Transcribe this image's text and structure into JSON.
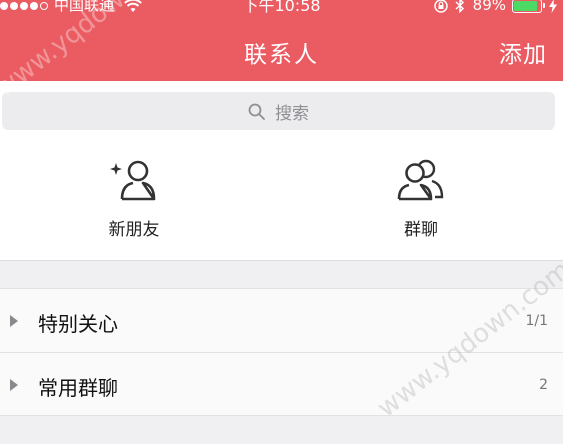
{
  "status_bar": {
    "carrier": "中国联通",
    "time": "下午10:58",
    "battery_text": "89%",
    "battery_level": 0.89,
    "battery_color": "#4cd964"
  },
  "nav": {
    "title": "联系人",
    "add_label": "添加",
    "background": "#ea5b62"
  },
  "search": {
    "placeholder": "搜索",
    "icon": "search-icon"
  },
  "quick_entries": [
    {
      "label": "新朋友",
      "icon": "new-friend-icon"
    },
    {
      "label": "群聊",
      "icon": "group-chat-icon"
    }
  ],
  "groups": [
    {
      "name": "特别关心",
      "count": "1/1",
      "icon": "triangle-right-icon"
    },
    {
      "name": "常用群聊",
      "count": "2",
      "icon": "triangle-right-icon"
    }
  ],
  "watermark": "www.yqdown.com"
}
